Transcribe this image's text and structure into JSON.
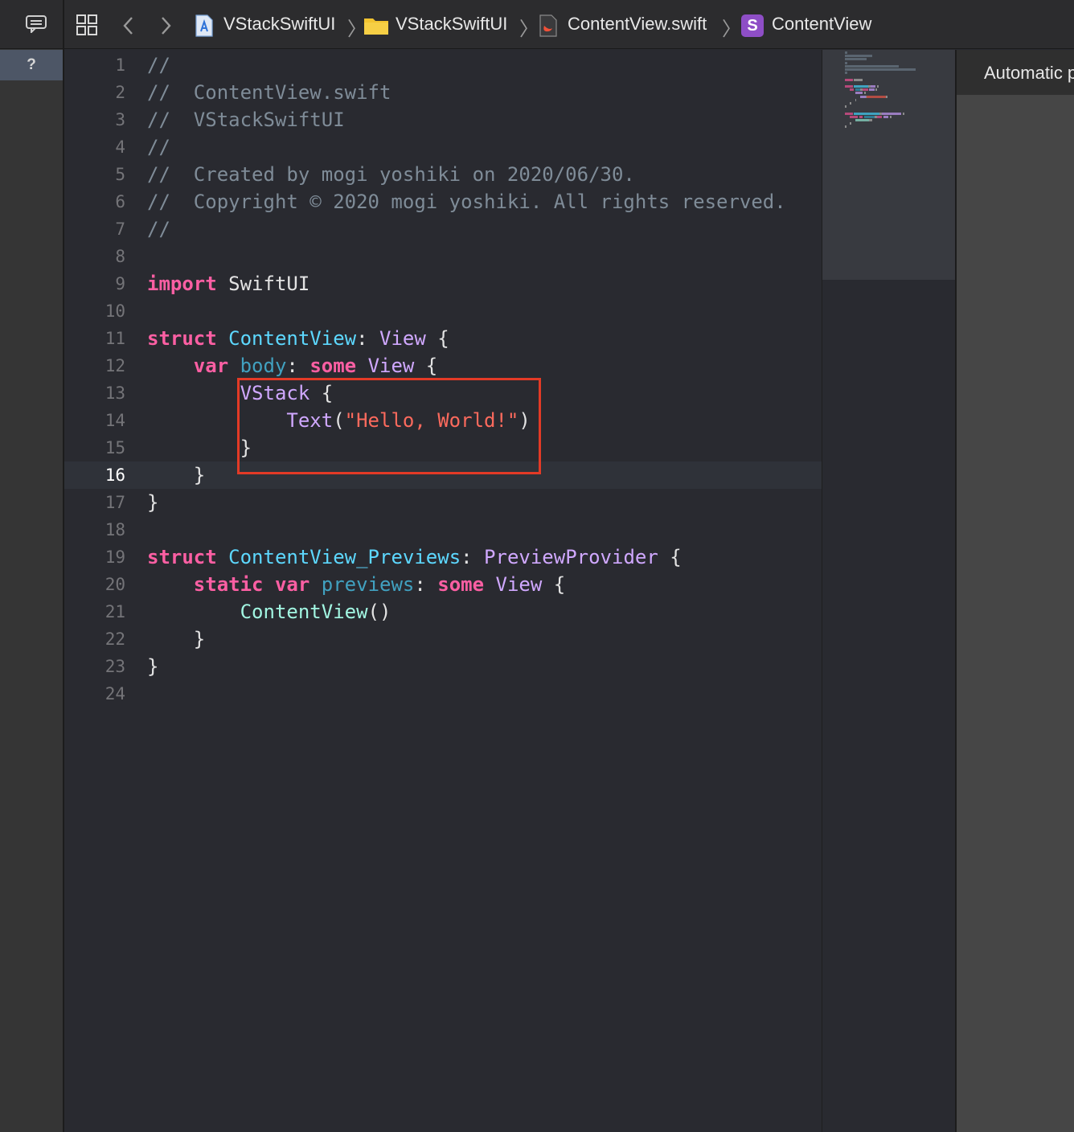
{
  "jumpbar": {
    "project": "VStackSwiftUI",
    "folder": "VStackSwiftUI",
    "file": "ContentView.swift",
    "symbol_badge": "S",
    "symbol": "ContentView"
  },
  "inspector": {
    "help_label": "?"
  },
  "preview": {
    "label": "Automatic p"
  },
  "editor": {
    "current_line": 16,
    "line_numbers": [
      "1",
      "2",
      "3",
      "4",
      "5",
      "6",
      "7",
      "8",
      "9",
      "10",
      "11",
      "12",
      "13",
      "14",
      "15",
      "16",
      "17",
      "18",
      "19",
      "20",
      "21",
      "22",
      "23",
      "24"
    ],
    "lines": [
      [
        {
          "t": "//",
          "c": "comment"
        }
      ],
      [
        {
          "t": "//  ContentView.swift",
          "c": "comment"
        }
      ],
      [
        {
          "t": "//  VStackSwiftUI",
          "c": "comment"
        }
      ],
      [
        {
          "t": "//",
          "c": "comment"
        }
      ],
      [
        {
          "t": "//  Created by mogi yoshiki on 2020/06/30.",
          "c": "comment"
        }
      ],
      [
        {
          "t": "//  Copyright © 2020 mogi yoshiki. All rights reserved.",
          "c": "comment"
        }
      ],
      [
        {
          "t": "//",
          "c": "comment"
        }
      ],
      [],
      [
        {
          "t": "import",
          "c": "kw"
        },
        {
          "t": " SwiftUI",
          "c": "plain"
        }
      ],
      [],
      [
        {
          "t": "struct",
          "c": "kw"
        },
        {
          "t": " ",
          "c": "plain"
        },
        {
          "t": "ContentView",
          "c": "decl"
        },
        {
          "t": ": ",
          "c": "plain"
        },
        {
          "t": "View",
          "c": "type"
        },
        {
          "t": " {",
          "c": "plain"
        }
      ],
      [
        {
          "t": "    ",
          "c": "plain"
        },
        {
          "t": "var",
          "c": "kw"
        },
        {
          "t": " ",
          "c": "plain"
        },
        {
          "t": "body",
          "c": "var"
        },
        {
          "t": ": ",
          "c": "plain"
        },
        {
          "t": "some",
          "c": "kw"
        },
        {
          "t": " ",
          "c": "plain"
        },
        {
          "t": "View",
          "c": "type"
        },
        {
          "t": " {",
          "c": "plain"
        }
      ],
      [
        {
          "t": "        ",
          "c": "plain"
        },
        {
          "t": "VStack",
          "c": "type"
        },
        {
          "t": " {",
          "c": "plain"
        }
      ],
      [
        {
          "t": "            ",
          "c": "plain"
        },
        {
          "t": "Text",
          "c": "type"
        },
        {
          "t": "(",
          "c": "plain"
        },
        {
          "t": "\"Hello, World!\"",
          "c": "str"
        },
        {
          "t": ")",
          "c": "plain"
        }
      ],
      [
        {
          "t": "        }",
          "c": "plain"
        }
      ],
      [
        {
          "t": "    }",
          "c": "plain"
        }
      ],
      [
        {
          "t": "}",
          "c": "plain"
        }
      ],
      [],
      [
        {
          "t": "struct",
          "c": "kw"
        },
        {
          "t": " ",
          "c": "plain"
        },
        {
          "t": "ContentView_Previews",
          "c": "decl"
        },
        {
          "t": ": ",
          "c": "plain"
        },
        {
          "t": "PreviewProvider",
          "c": "type"
        },
        {
          "t": " {",
          "c": "plain"
        }
      ],
      [
        {
          "t": "    ",
          "c": "plain"
        },
        {
          "t": "static",
          "c": "kw"
        },
        {
          "t": " ",
          "c": "plain"
        },
        {
          "t": "var",
          "c": "kw"
        },
        {
          "t": " ",
          "c": "plain"
        },
        {
          "t": "previews",
          "c": "var"
        },
        {
          "t": ": ",
          "c": "plain"
        },
        {
          "t": "some",
          "c": "kw"
        },
        {
          "t": " ",
          "c": "plain"
        },
        {
          "t": "View",
          "c": "type"
        },
        {
          "t": " {",
          "c": "plain"
        }
      ],
      [
        {
          "t": "        ",
          "c": "plain"
        },
        {
          "t": "ContentView",
          "c": "funcname"
        },
        {
          "t": "()",
          "c": "plain"
        }
      ],
      [
        {
          "t": "    }",
          "c": "plain"
        }
      ],
      [
        {
          "t": "}",
          "c": "plain"
        }
      ],
      []
    ]
  },
  "colors": {
    "comment": "#7f8c98",
    "keyword": "#fc5fa3",
    "type": "#d0a8ff",
    "declaration": "#5dd8ff",
    "variable": "#41a1c0",
    "string": "#fc6a5d",
    "highlight_box": "#e33a26"
  }
}
